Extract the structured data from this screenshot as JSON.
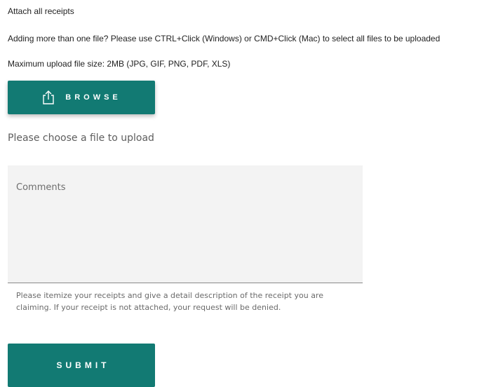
{
  "instructions": {
    "heading": "Attach all receipts",
    "multi_file_hint": "Adding more than one file? Please use CTRL+Click (Windows) or CMD+Click (Mac) to select all files to be uploaded",
    "size_limit": "Maximum upload file size: 2MB (JPG, GIF, PNG, PDF, XLS)"
  },
  "upload": {
    "browse_label": "BROWSE",
    "icon": "upload-share-icon",
    "status_text": "Please choose a file to upload"
  },
  "comments": {
    "placeholder": "Comments",
    "value": "",
    "helper_text": "Please itemize your receipts and give a detail description of the receipt you are claiming. If your receipt is not attached, your request will be denied."
  },
  "submit": {
    "label": "SUBMIT"
  },
  "colors": {
    "accent": "#127a73",
    "field_bg": "#f3f3f3"
  }
}
